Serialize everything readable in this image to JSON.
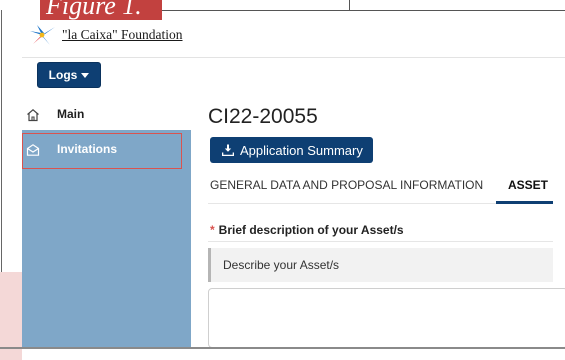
{
  "figure_caption": "Figure 1.",
  "header": {
    "logo_text": "\"la Caixa\" Foundation",
    "logo_icon": "caixa-star-logo",
    "logs_button_label": "Logs"
  },
  "sidebar": {
    "items": [
      {
        "label": "Main",
        "icon": "home-icon"
      },
      {
        "label": "Invitations",
        "icon": "envelope-icon"
      }
    ]
  },
  "main": {
    "title": "CI22-20055",
    "summary_button_label": "Application Summary",
    "tabs": [
      {
        "label": "GENERAL DATA AND PROPOSAL INFORMATION",
        "active": false
      },
      {
        "label": "ASSET",
        "active": true
      }
    ],
    "field": {
      "required_marker": "*",
      "label": "Brief description of your Asset/s",
      "hint": "Describe your Asset/s",
      "value": ""
    }
  },
  "colors": {
    "primary": "#0e3f73",
    "sidebar": "#7fa7c8",
    "highlight_border": "#d9534f",
    "caption_tab": "#c2413f"
  }
}
